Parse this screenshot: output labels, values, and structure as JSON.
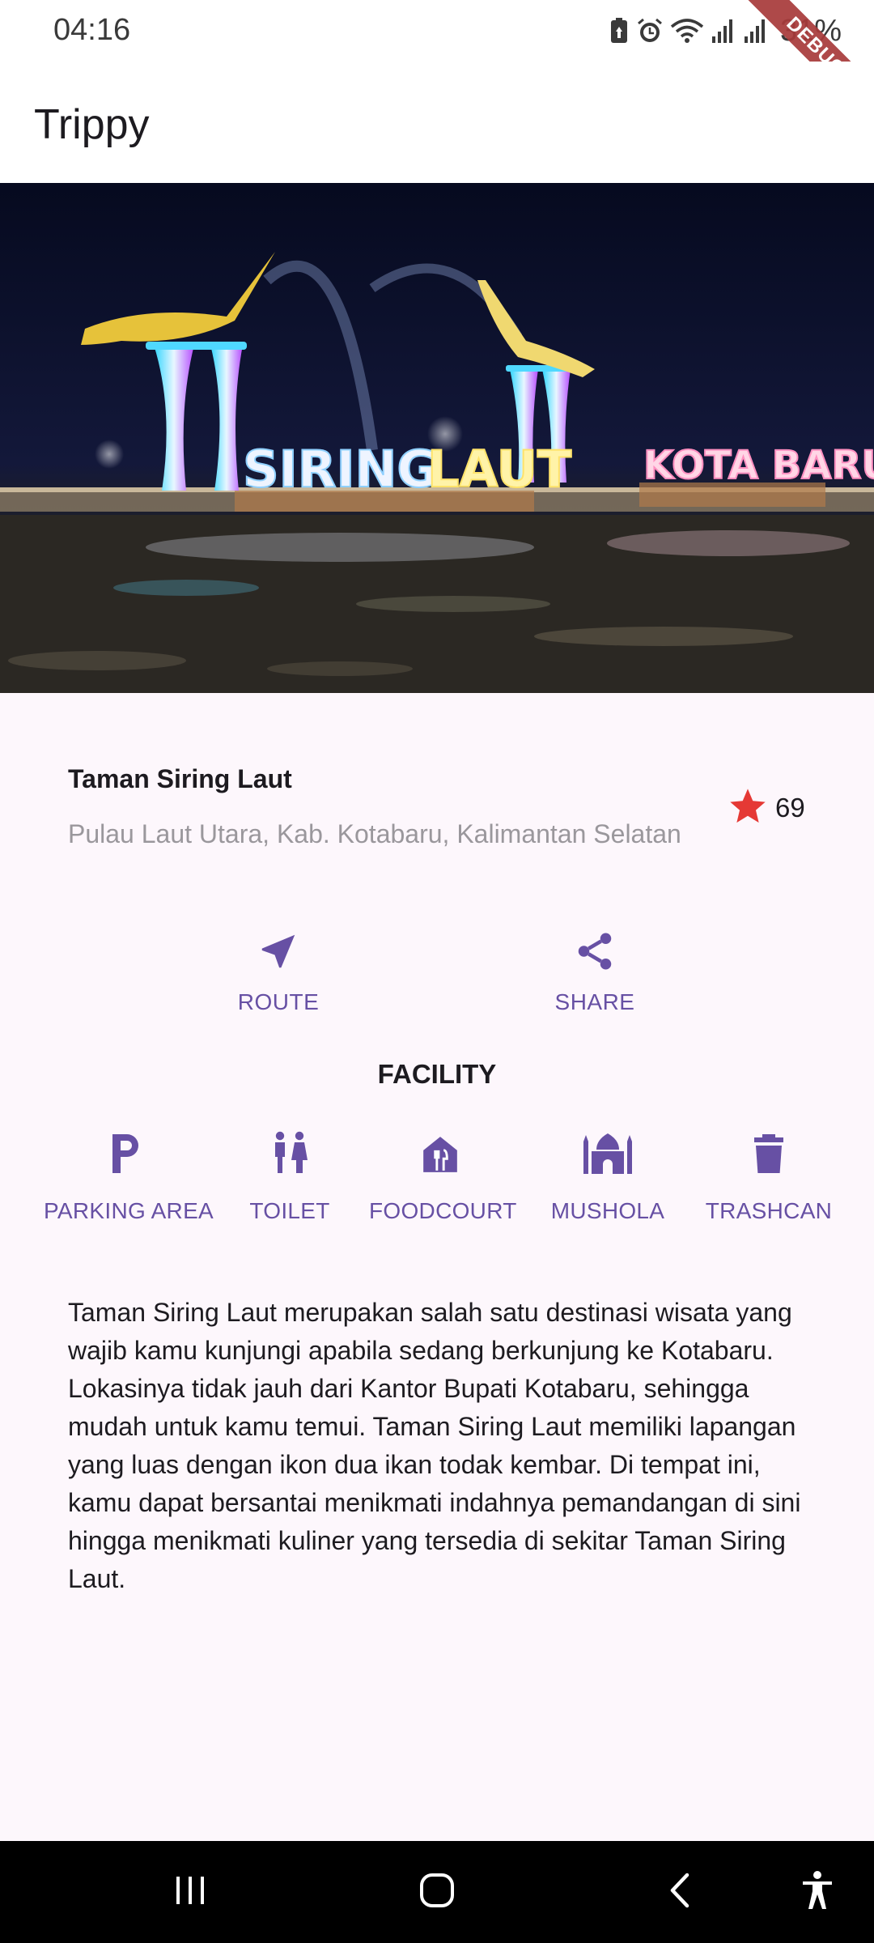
{
  "status_bar": {
    "time": "04:16",
    "battery": "31%",
    "icons": [
      "battery-saver-icon",
      "alarm-icon",
      "wifi-icon",
      "signal-icon",
      "signal-icon"
    ],
    "debug_banner": "DEBUG"
  },
  "app_bar": {
    "title": "Trippy"
  },
  "hero": {
    "icon": "place-photo"
  },
  "place": {
    "name": "Taman Siring Laut",
    "location": "Pulau Laut Utara, Kab. Kotabaru, Kalimantan Selatan",
    "rating": "69",
    "rating_icon": "star-icon"
  },
  "actions": [
    {
      "label": "ROUTE",
      "icon": "navigation-arrow-icon"
    },
    {
      "label": "SHARE",
      "icon": "share-icon"
    }
  ],
  "facility": {
    "title": "FACILITY",
    "items": [
      {
        "label": "PARKING AREA",
        "icon": "parking-icon"
      },
      {
        "label": "TOILET",
        "icon": "toilet-icon"
      },
      {
        "label": "FOODCOURT",
        "icon": "restaurant-icon"
      },
      {
        "label": "MUSHOLA",
        "icon": "mosque-icon"
      },
      {
        "label": "TRASHCAN",
        "icon": "trash-icon"
      }
    ]
  },
  "description": "Taman Siring Laut merupakan salah satu destinasi wisata yang wajib kamu kunjungi apabila sedang berkunjung ke Kotabaru. Lokasinya tidak jauh dari Kantor Bupati Kotabaru, sehingga mudah untuk kamu temui. Taman Siring Laut memiliki lapangan yang luas dengan ikon dua ikan todak kembar. Di tempat ini, kamu dapat bersantai menikmati indahnya pemandangan di sini hingga menikmati kuliner yang tersedia di sekitar Taman Siring Laut.",
  "colors": {
    "accent": "#6750a4",
    "star": "#e53935",
    "background": "#fdf7fc"
  },
  "nav_bar": {
    "icons": [
      "recent-apps-icon",
      "home-icon",
      "back-icon",
      "accessibility-icon"
    ]
  }
}
